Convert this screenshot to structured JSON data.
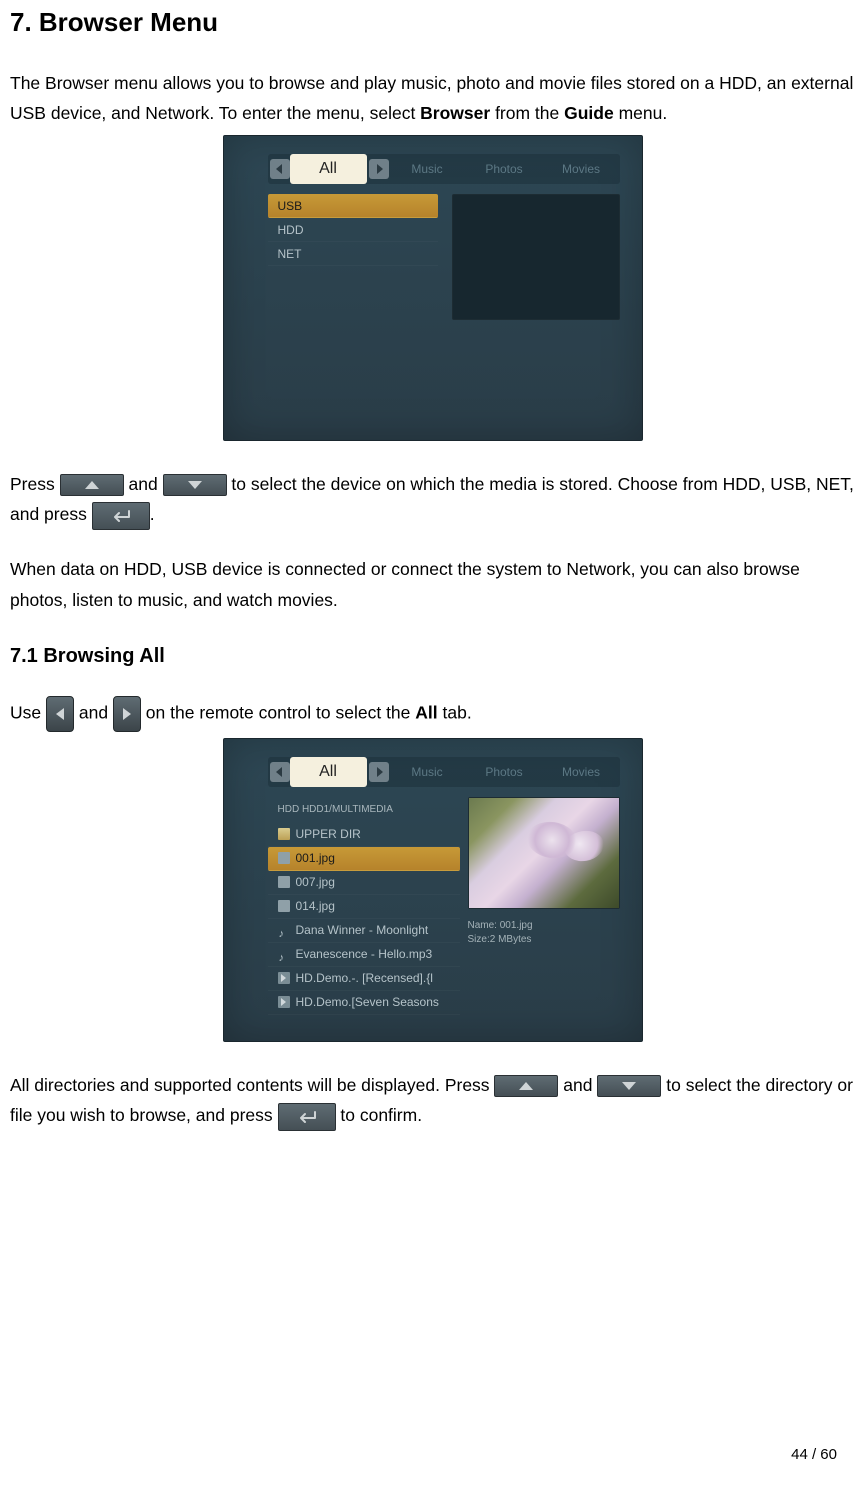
{
  "heading": "7. Browser Menu",
  "intro": {
    "p1a": "The Browser menu allows you to browse and play music, photo and movie files stored on a HDD, an external USB device, and Network. To enter the menu, select ",
    "bold1": "Browser",
    "p1b": " from the ",
    "bold2": "Guide",
    "p1c": " menu."
  },
  "shot1": {
    "tabs": {
      "all": "All",
      "music": "Music",
      "photos": "Photos",
      "movies": "Movies"
    },
    "items": {
      "usb": "USB",
      "hdd": "HDD",
      "net": "NET"
    }
  },
  "press_para": {
    "a": "Press ",
    "b": " and ",
    "c": " to select the device on which the media is stored. Choose from HDD, USB, NET, and press ",
    "d": "."
  },
  "para2": "When data on HDD, USB device is connected or connect the system to Network, you can also browse photos, listen to music, and watch movies.",
  "sub_heading": "7.1 Browsing All",
  "use_para": {
    "a": "Use ",
    "b": " and ",
    "c": " on the remote control to select the ",
    "bold": "All",
    "d": " tab."
  },
  "shot2": {
    "tabs": {
      "all": "All",
      "music": "Music",
      "photos": "Photos",
      "movies": "Movies"
    },
    "header": "HDD HDD1/MULTIMEDIA",
    "files": {
      "f0": "UPPER DIR",
      "f1": "001.jpg",
      "f2": "007.jpg",
      "f3": "014.jpg",
      "f4": "Dana Winner - Moonlight",
      "f5": "Evanescence - Hello.mp3",
      "f6": "HD.Demo.-. [Recensed].{l",
      "f7": "HD.Demo.[Seven Seasons"
    },
    "info": {
      "name": "Name: 001.jpg",
      "size": "Size:2 MBytes"
    }
  },
  "final_para": {
    "a": "All directories and supported contents will be displayed. Press ",
    "b": " and ",
    "c": " to select the directory or file you wish to browse, and press ",
    "d": " to confirm."
  },
  "page_num": "44 / 60"
}
